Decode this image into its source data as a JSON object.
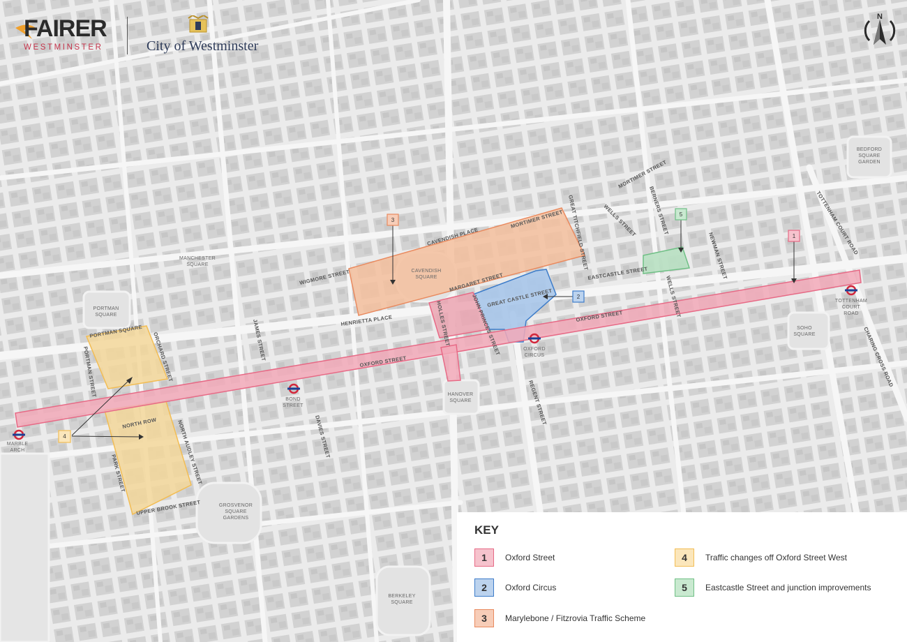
{
  "branding": {
    "logo_main": "FAIRER",
    "logo_sub": "WESTMINSTER",
    "council": "City of Westminster"
  },
  "compass": {
    "north": "N"
  },
  "key": {
    "title": "KEY",
    "items": [
      {
        "number": "1",
        "label": "Oxford Street",
        "color": "#e76a86",
        "fill": "#f6c3cd"
      },
      {
        "number": "2",
        "label": "Oxford Circus",
        "color": "#3d7cc9",
        "fill": "#bcd3ee"
      },
      {
        "number": "3",
        "label": "Marylebone / Fitzrovia Traffic Scheme",
        "color": "#e98a5f",
        "fill": "#f7cdb8"
      },
      {
        "number": "4",
        "label": "Traffic changes off Oxford Street West",
        "color": "#f2bd55",
        "fill": "#fbe6bb"
      },
      {
        "number": "5",
        "label": "Eastcastle Street and junction improvements",
        "color": "#6fbf85",
        "fill": "#c9e9d0"
      }
    ]
  },
  "map": {
    "streets": {
      "oxford_street_west": "OXFORD STREET",
      "oxford_street_east": "OXFORD STREET",
      "cavendish_place": "CAVENDISH PLACE",
      "mortimer_street_zone": "MORTIMER STREET",
      "mortimer_street_north": "MORTIMER STREET",
      "margaret_street": "MARGARET STREET",
      "great_castle_street": "GREAT CASTLE STREET",
      "great_titchfield_street": "GREAT TITCHFIELD STREET",
      "wigmore_street": "WIGMORE STREET",
      "henrietta_place": "HENRIETTA PLACE",
      "holles_street": "HOLLES STREET",
      "john_princes_street": "JOHN PRINCES STREET",
      "wells_street_north": "WELLS STREET",
      "wells_street_south": "WELLS STREET",
      "berners_street": "BERNERS STREET",
      "newman_street": "NEWMAN STREET",
      "eastcastle_street": "EASTCASTLE STREET",
      "tottenham_court_road": "TOTTENHAM COURT ROAD",
      "charing_cross_road": "CHARING CROSS ROAD",
      "regent_street": "REGENT STREET",
      "davies_street": "DAVIES STREET",
      "james_street": "JAMES STREET",
      "portman_square_st": "PORTMAN SQUARE",
      "portman_street": "PORTMAN STREET",
      "orchard_street": "ORCHARD STREET",
      "north_row": "NORTH ROW",
      "north_audley_street": "NORTH AUDLEY STREET",
      "park_street": "PARK STREET",
      "upper_brook_street": "UPPER BROOK STREET"
    },
    "places": {
      "manchester_square": "MANCHESTER SQUARE",
      "portman_square": "PORTMAN SQUARE",
      "cavendish_square": "CAVENDISH SQUARE",
      "hanover_square": "HANOVER SQUARE",
      "soho_square": "SOHO SQUARE",
      "bedford_square_garden": "BEDFORD SQUARE GARDEN",
      "grosvenor_square_gardens": "GROSVENOR SQUARE GARDENS",
      "berkeley_square": "BERKELEY SQUARE"
    },
    "stations": {
      "marble_arch": "MARBLE ARCH",
      "bond_street": "BOND STREET",
      "oxford_circus": "OXFORD CIRCUS",
      "tottenham_court_road": "TOTTENHAM COURT ROAD"
    },
    "markers": [
      "1",
      "2",
      "3",
      "4",
      "5"
    ]
  }
}
